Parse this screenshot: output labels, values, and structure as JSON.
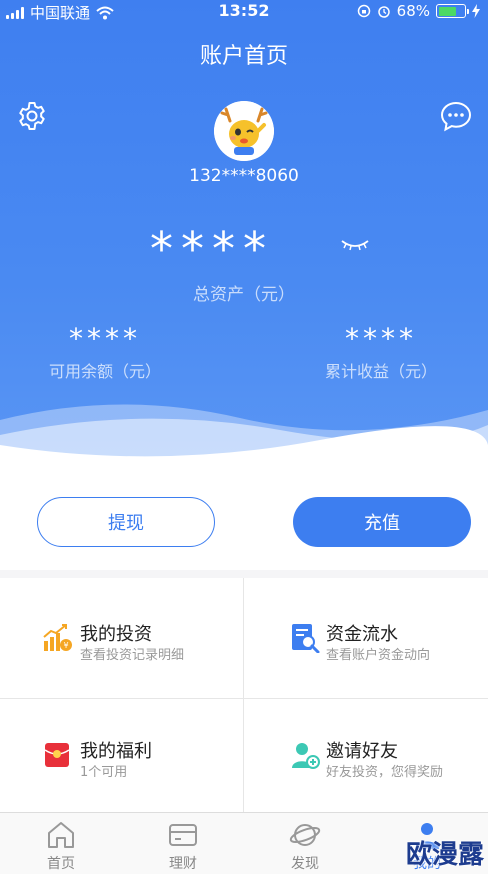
{
  "status_bar": {
    "carrier": "中国联通",
    "time": "13:52",
    "battery": "68%",
    "battery_level": 0.68
  },
  "header": {
    "title": "账户首页",
    "phone": "132****8060",
    "total_assets_value": "****",
    "total_assets_label": "总资产（元）",
    "available_value": "****",
    "available_label": "可用余额（元）",
    "earnings_value": "****",
    "earnings_label": "累计收益（元）"
  },
  "actions": {
    "withdraw": "提现",
    "recharge": "充值"
  },
  "menu": [
    {
      "title": "我的投资",
      "subtitle": "查看投资记录明细",
      "icon": "investment-chart-icon"
    },
    {
      "title": "资金流水",
      "subtitle": "查看账户资金动向",
      "icon": "fund-flow-icon"
    },
    {
      "title": "我的福利",
      "subtitle": "1个可用",
      "icon": "red-envelope-icon"
    },
    {
      "title": "邀请好友",
      "subtitle": "好友投资，您得奖励",
      "icon": "invite-friend-icon"
    }
  ],
  "tabs": [
    {
      "label": "首页",
      "icon": "home-icon"
    },
    {
      "label": "理财",
      "icon": "wallet-card-icon"
    },
    {
      "label": "发现",
      "icon": "planet-icon"
    },
    {
      "label": "我的",
      "icon": "profile-icon",
      "active": true
    }
  ],
  "watermark": "欧漫露",
  "colors": {
    "primary": "#3d7ef0",
    "background": "#f5f5f7",
    "battery": "#4cd964"
  }
}
